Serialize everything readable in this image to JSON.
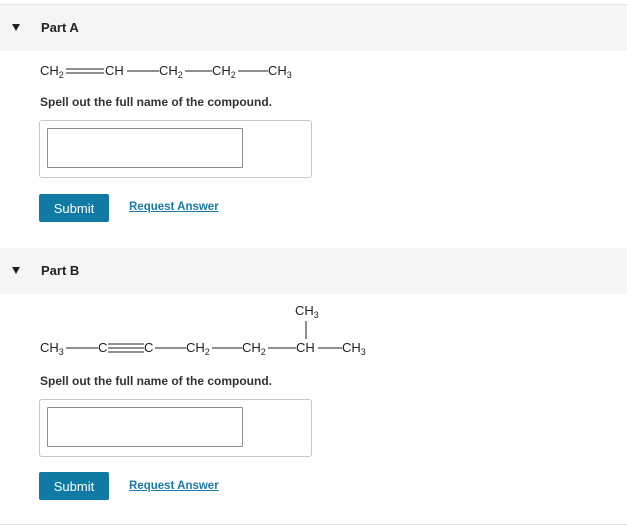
{
  "parts": [
    {
      "title": "Part A",
      "formula": {
        "g1": "CH",
        "s1": "2",
        "g2": "CH",
        "g3": "CH",
        "s3": "2",
        "g4": "CH",
        "s4": "2",
        "g5": "CH",
        "s5": "3"
      },
      "prompt": "Spell out the full name of the compound.",
      "answer_value": "",
      "submit_label": "Submit",
      "request_label": "Request Answer"
    },
    {
      "title": "Part B",
      "formula": {
        "g1": "CH",
        "s1": "3",
        "g2": "C",
        "g3": "C",
        "g4": "CH",
        "s4": "2",
        "g5": "CH",
        "s5": "2",
        "g6": "CH",
        "g7": "CH",
        "s7": "3",
        "branch": "CH",
        "sbranch": "3"
      },
      "prompt": "Spell out the full name of the compound.",
      "answer_value": "",
      "submit_label": "Submit",
      "request_label": "Request Answer"
    }
  ],
  "colors": {
    "accent": "#0f7aa3",
    "link": "#1a7aa8",
    "header_bg": "#f5f5f5"
  }
}
